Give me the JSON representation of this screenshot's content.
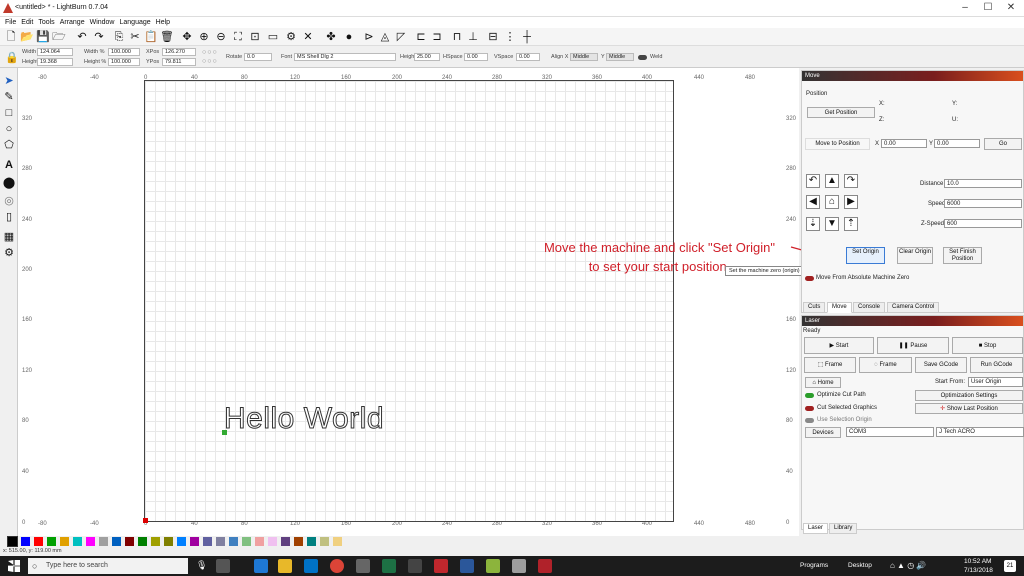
{
  "window": {
    "title": "<untitled> * - LightBurn 0.7.04",
    "min": "–",
    "max": "☐",
    "close": "✕"
  },
  "menu": [
    "File",
    "Edit",
    "Tools",
    "Arrange",
    "Window",
    "Language",
    "Help"
  ],
  "props": {
    "width_label": "Width",
    "width": "124.064",
    "height_label": "Height",
    "height": "19.368",
    "widthpct_label": "Width %",
    "widthpct": "100.000",
    "heightpct_label": "Height %",
    "heightpct": "100.000",
    "xpos_label": "XPos",
    "xpos": "126.270",
    "ypos_label": "YPos",
    "ypos": "79.811",
    "rotate_label": "Rotate",
    "rotate": "0.0",
    "font_label": "Font",
    "font": "MS Shell Dlg 2",
    "fheight_label": "Height",
    "fheight": "25.00",
    "hspace_label": "HSpace",
    "hspace": "0.00",
    "vspace_label": "VSpace",
    "vspace": "0.00",
    "alignx_label": "Align X",
    "alignx": "Middle",
    "aligny_label": "Y",
    "aligny": "Middle",
    "weld_label": "Weld"
  },
  "ruler_top": [
    "-80",
    "-40",
    "0",
    "40",
    "80",
    "120",
    "160",
    "200",
    "240",
    "280",
    "320",
    "360",
    "400",
    "440",
    "480"
  ],
  "ruler_left": [
    "320",
    "280",
    "240",
    "200",
    "160",
    "120",
    "80",
    "40",
    "0"
  ],
  "ruler_right": [
    "320",
    "280",
    "240",
    "200",
    "160",
    "120",
    "80",
    "40",
    "0"
  ],
  "ruler_bottom": [
    "-80",
    "-40",
    "0",
    "40",
    "80",
    "120",
    "160",
    "200",
    "240",
    "280",
    "320",
    "360",
    "400",
    "440",
    "480"
  ],
  "canvas_text": "Hello World",
  "annotation": {
    "line1": "Move the machine and click \"Set Origin\"",
    "line2": "to set your start position."
  },
  "tooltip": "Set the machine zero (origin) to the current position",
  "status_coord": "x: 515.00, y: 119.00 mm",
  "palette": [
    "#000000",
    "#0000ff",
    "#ff0000",
    "#00a000",
    "#e0a000",
    "#00c0c0",
    "#ff00ff",
    "#a0a0a0",
    "#0060c0",
    "#800000",
    "#008000",
    "#a0a000",
    "#808000",
    "#0080ff",
    "#a000a0",
    "#6060a0",
    "#8080a0",
    "#4080c0",
    "#80c080",
    "#f0a0a0",
    "#f0c0f0",
    "#604080",
    "#a04000",
    "#008080",
    "#c0c080",
    "#f0d080"
  ],
  "move": {
    "header": "Move",
    "position_label": "Position",
    "get_position": "Get Position",
    "x_label": "X:",
    "y_label": "Y:",
    "z_label": "Z:",
    "u_label": "U:",
    "move_to": "Move to Position",
    "mx_label": "X",
    "mx": "0.00",
    "my_label": "Y",
    "my": "0.00",
    "go": "Go",
    "distance_label": "Distance",
    "distance": "10.0",
    "speed_label": "Speed",
    "speed": "6000",
    "zspeed_label": "Z-Speed",
    "zspeed": "600",
    "set_origin": "Set Origin",
    "clear_origin": "Clear Origin",
    "set_finish": "Set Finish Position",
    "move_from_abs": "Move From Absolute Machine Zero"
  },
  "tabs1": [
    "Cuts",
    "Move",
    "Console",
    "Camera Control"
  ],
  "laser": {
    "header": "Laser",
    "ready": "Ready",
    "start": "Start",
    "pause": "Pause",
    "stop": "Stop",
    "frame1": "Frame",
    "frame2": "Frame",
    "save_gcode": "Save GCode",
    "run_gcode": "Run GCode",
    "home": "Home",
    "start_from_label": "Start From:",
    "start_from": "User Origin",
    "optimize_cut": "Optimize Cut Path",
    "optimization_settings": "Optimization Settings",
    "cut_selected": "Cut Selected Graphics",
    "show_last": "Show Last Position",
    "use_selection": "Use Selection Origin",
    "devices": "Devices",
    "port": "COM3",
    "device": "J Tech ACRO"
  },
  "tabs2": [
    "Laser",
    "Library"
  ],
  "taskbar": {
    "search": "Type here to search",
    "programs": "Programs",
    "desktop": "Desktop",
    "time": "10:52 AM",
    "date": "7/13/2018",
    "notif": "21"
  }
}
